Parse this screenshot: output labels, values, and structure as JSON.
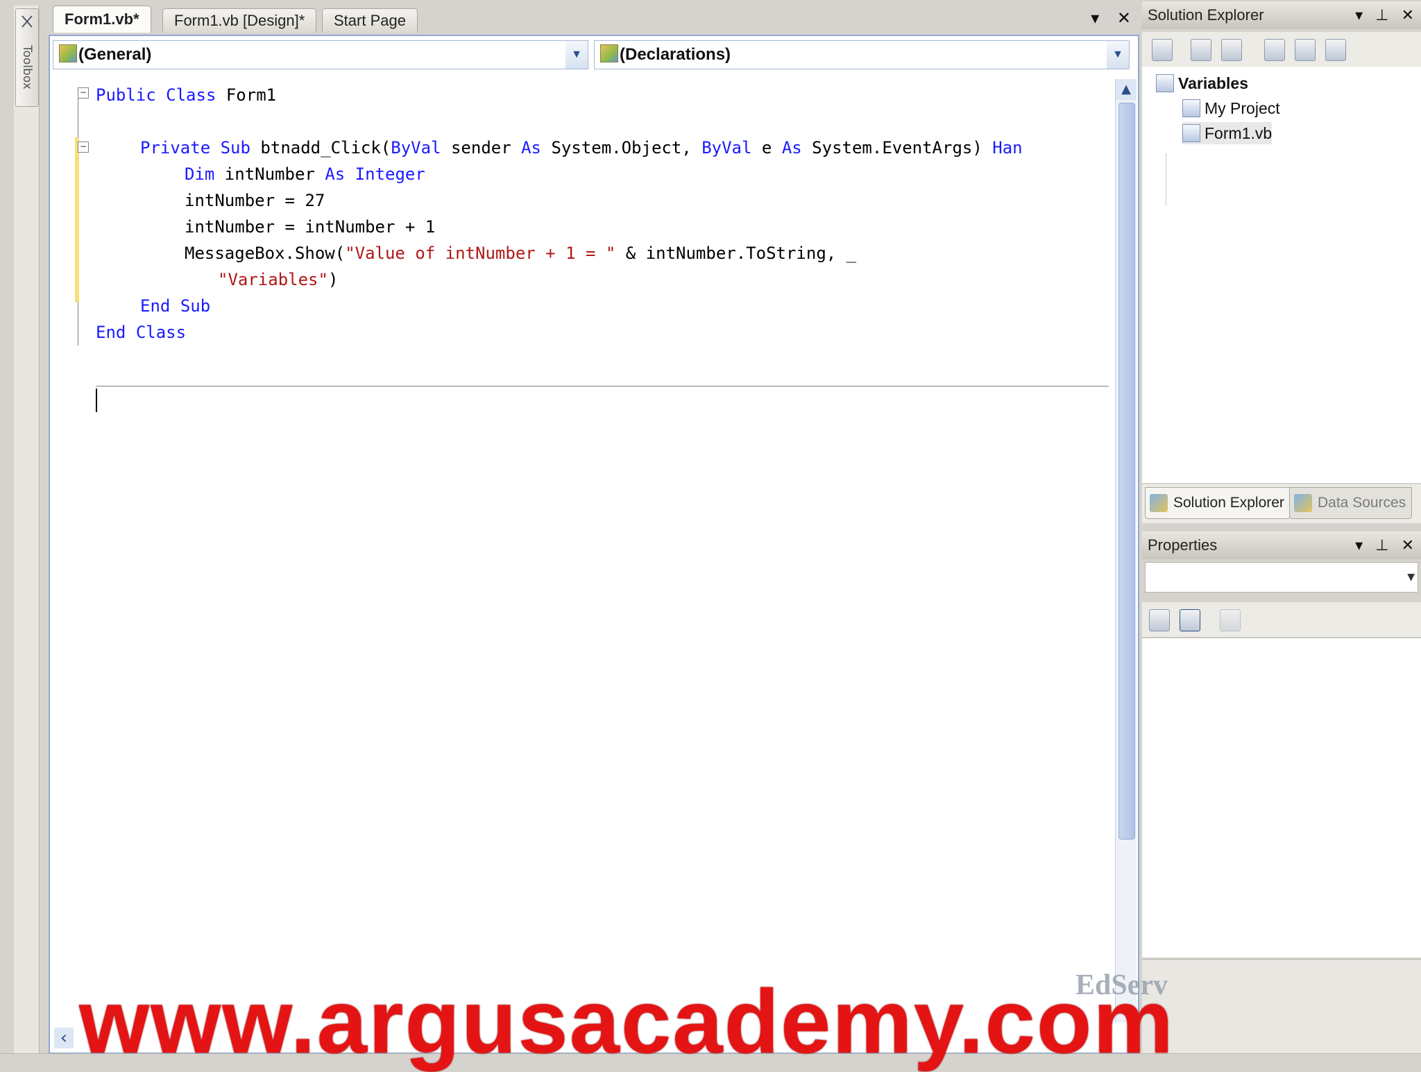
{
  "toolbox": {
    "label": "Toolbox"
  },
  "document_tabs": {
    "tabs": [
      {
        "label": "Form1.vb*",
        "active": true
      },
      {
        "label": "Form1.vb [Design]*",
        "active": false
      },
      {
        "label": "Start Page",
        "active": false
      }
    ],
    "dropdown_glyph": "▾",
    "close_glyph": "✕"
  },
  "editor": {
    "class_combo": "(General)",
    "method_combo": "(Declarations)",
    "code": {
      "l1_kw1": "Public",
      "l1_kw2": "Class",
      "l1_txt": " Form1",
      "l3_kw1": "Private",
      "l3_kw2": "Sub",
      "l3_txt1": " btnadd_Click(",
      "l3_kw3": "ByVal",
      "l3_txt2": " sender ",
      "l3_kw4": "As",
      "l3_txt3": " System.Object, ",
      "l3_kw5": "ByVal",
      "l3_txt4": " e ",
      "l3_kw6": "As",
      "l3_txt5": " System.EventArgs) ",
      "l3_kw7": "Han",
      "l4_kw1": "Dim",
      "l4_txt1": " intNumber ",
      "l4_kw2": "As",
      "l4_kw3": "Integer",
      "l5": "intNumber = 27",
      "l6": "intNumber = intNumber + 1",
      "l7_txt1": "MessageBox.Show(",
      "l7_str": "\"Value of intNumber + 1 = \"",
      "l7_txt2": " & intNumber.ToString, _",
      "l8_str": "\"Variables\"",
      "l8_txt": ")",
      "l9_kw1": "End",
      "l9_kw2": "Sub",
      "l10_kw1": "End",
      "l10_kw2": "Class"
    }
  },
  "solution_explorer": {
    "title": "Solution Explorer",
    "tree": [
      {
        "label": "Variables",
        "bold": true
      },
      {
        "label": "My Project"
      },
      {
        "label": "Form1.vb"
      }
    ],
    "bottom_tabs": [
      "Solution Explorer",
      "Data Sources"
    ]
  },
  "properties": {
    "title": "Properties"
  },
  "panel_controls": {
    "dropdown": "▾",
    "pin": "⊥",
    "close": "✕"
  },
  "overlay": {
    "watermark": "www.argusacademy.com",
    "logo_text": "EdServ"
  }
}
